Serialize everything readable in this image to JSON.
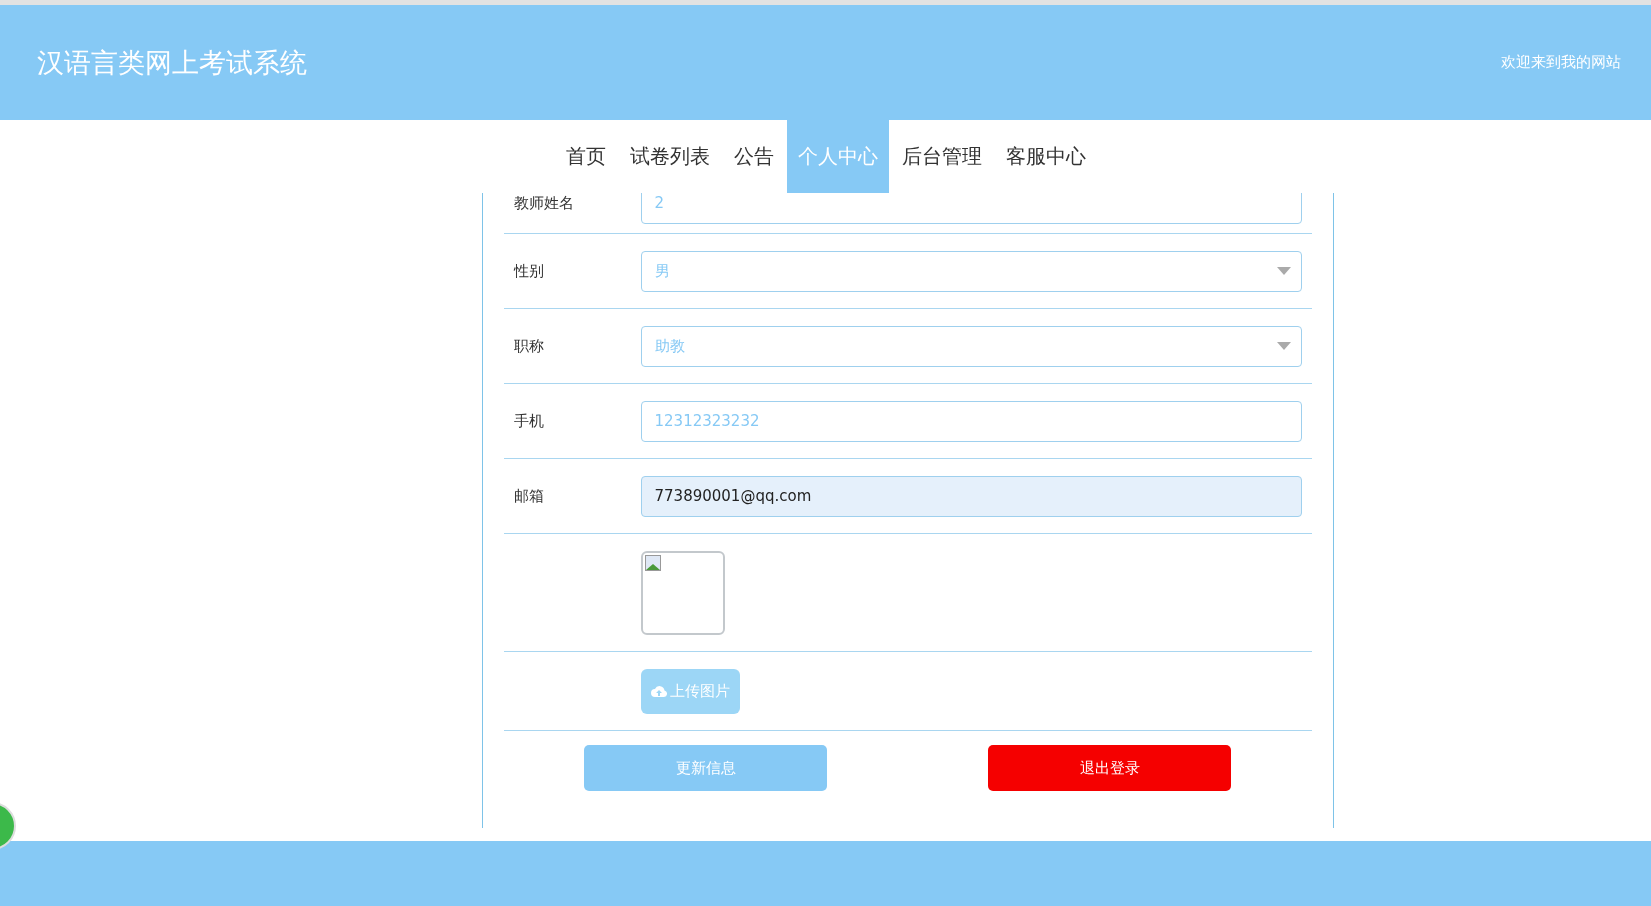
{
  "header": {
    "title": "汉语言类网上考试系统",
    "welcome": "欢迎来到我的网站"
  },
  "nav": [
    {
      "label": "首页",
      "selected": false
    },
    {
      "label": "试卷列表",
      "selected": false
    },
    {
      "label": "公告",
      "selected": false
    },
    {
      "label": "个人中心",
      "selected": true
    },
    {
      "label": "后台管理",
      "selected": false
    },
    {
      "label": "客服中心",
      "selected": false
    }
  ],
  "form": {
    "fields": [
      {
        "kind": "input",
        "label": "教师姓名",
        "value": "2",
        "autofilled": false
      },
      {
        "kind": "select",
        "label": "性别",
        "value": "男",
        "autofilled": false
      },
      {
        "kind": "select",
        "label": "职称",
        "value": "助教",
        "autofilled": false
      },
      {
        "kind": "input",
        "label": "手机",
        "value": "12312323232",
        "autofilled": false
      },
      {
        "kind": "input",
        "label": "邮箱",
        "value": "773890001@qq.com",
        "autofilled": true
      }
    ],
    "upload_button": "上传图片",
    "update_button": "更新信息",
    "logout_button": "退出登录"
  }
}
